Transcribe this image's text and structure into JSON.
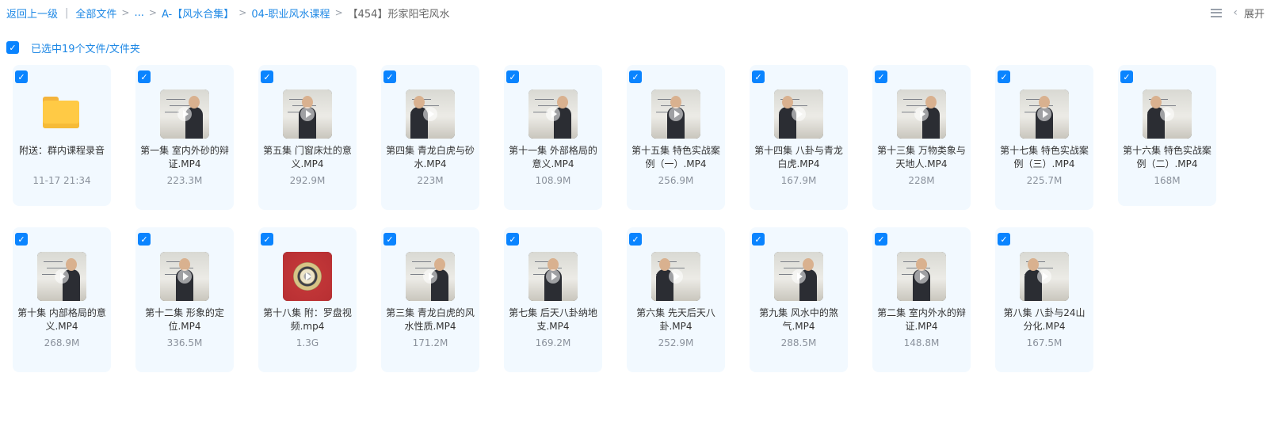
{
  "breadcrumb": {
    "back": "返回上一级",
    "sep": "|",
    "items": [
      "全部文件",
      "...",
      "A-【风水合集】",
      "04-职业风水课程"
    ],
    "current": "【454】形家阳宅风水"
  },
  "toolbar": {
    "expand_label": "展开"
  },
  "selection": {
    "text": "已选中19个文件/文件夹",
    "check": "✓"
  },
  "files": [
    {
      "type": "folder",
      "name": "附送：群内课程录音",
      "meta": "11-17 21:34"
    },
    {
      "type": "video",
      "name": "第一集 室内外砂的辩证.MP4",
      "meta": "223.3M"
    },
    {
      "type": "video",
      "name": "第五集 门窗床灶的意义.MP4",
      "meta": "292.9M"
    },
    {
      "type": "video",
      "name": "第四集 青龙白虎与砂水.MP4",
      "meta": "223M"
    },
    {
      "type": "video",
      "name": "第十一集 外部格局的意义.MP4",
      "meta": "108.9M"
    },
    {
      "type": "video",
      "name": "第十五集 特色实战案例（一）.MP4",
      "meta": "256.9M"
    },
    {
      "type": "video",
      "name": "第十四集 八卦与青龙白虎.MP4",
      "meta": "167.9M"
    },
    {
      "type": "video",
      "name": "第十三集 万物类象与天地人.MP4",
      "meta": "228M"
    },
    {
      "type": "video",
      "name": "第十七集 特色实战案例（三）.MP4",
      "meta": "225.7M"
    },
    {
      "type": "video",
      "name": "第十六集 特色实战案例（二）.MP4",
      "meta": "168M"
    },
    {
      "type": "video",
      "name": "第十集 内部格局的意义.MP4",
      "meta": "268.9M"
    },
    {
      "type": "video",
      "name": "第十二集 形象的定位.MP4",
      "meta": "336.5M"
    },
    {
      "type": "compass",
      "name": "第十八集 附：罗盘视频.mp4",
      "meta": "1.3G"
    },
    {
      "type": "video",
      "name": "第三集 青龙白虎的风水性质.MP4",
      "meta": "171.2M"
    },
    {
      "type": "video",
      "name": "第七集 后天八卦纳地支.MP4",
      "meta": "169.2M"
    },
    {
      "type": "video",
      "name": "第六集 先天后天八卦.MP4",
      "meta": "252.9M"
    },
    {
      "type": "video",
      "name": "第九集 风水中的煞气.MP4",
      "meta": "288.5M"
    },
    {
      "type": "video",
      "name": "第二集 室内外水的辩证.MP4",
      "meta": "148.8M"
    },
    {
      "type": "video",
      "name": "第八集 八卦与24山分化.MP4",
      "meta": "167.5M"
    }
  ]
}
